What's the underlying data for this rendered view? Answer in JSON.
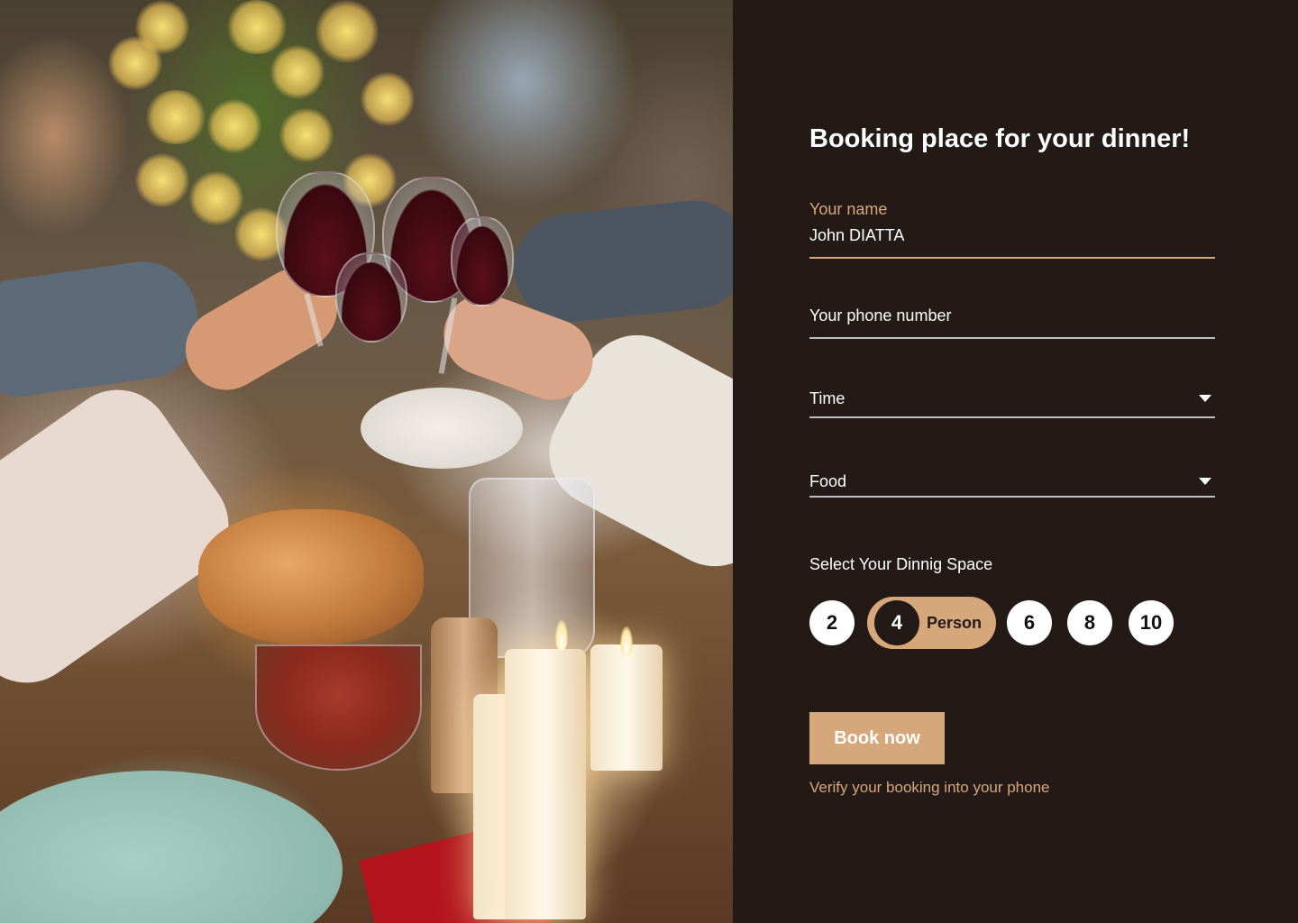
{
  "photo": {
    "description_icon": "dinner-toast-photo"
  },
  "form": {
    "title": "Booking place for your dinner!",
    "name": {
      "label": "Your name",
      "value": "John DIATTA"
    },
    "phone": {
      "placeholder": "Your phone number"
    },
    "time": {
      "placeholder": "Time",
      "icon": "caret-down-icon"
    },
    "food": {
      "placeholder": "Food",
      "icon": "caret-down-icon"
    },
    "dining_space": {
      "label": "Select Your Dinnig Space",
      "options": [
        "2",
        "4",
        "6",
        "8",
        "10"
      ],
      "selected": "4",
      "selected_unit": "Person"
    },
    "submit_label": "Book now",
    "hint": "Verify your booking into your phone"
  },
  "colors": {
    "background": "#231a17",
    "accent": "#d6a77b",
    "text": "#ffffff"
  }
}
